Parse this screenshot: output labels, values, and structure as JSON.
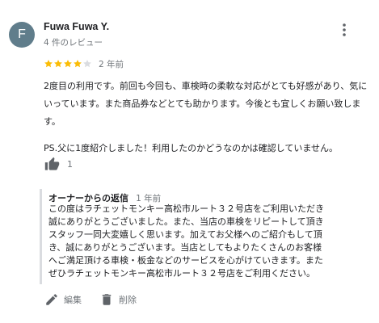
{
  "reviewer": {
    "avatar_letter": "F",
    "avatar_color": "#607d8b",
    "name": "Fuwa Fuwa Y.",
    "review_count": "4 件のレビュー"
  },
  "review": {
    "rating": 4,
    "max_rating": 5,
    "star_color": "#fbbc04",
    "star_empty_color": "#dadce0",
    "date": "2 年前",
    "paragraphs": [
      "2度目の利用です。前回も今回も、車検時の柔軟な対応がとても好感があり、気にいっています。また商品券などとても助かります。今後とも宜しくお願い致します。",
      "PS.父に1度紹介しました！利用したのかどうなのかは確認していません。"
    ],
    "like_count": "1"
  },
  "owner_reply": {
    "label": "オーナーからの返信",
    "date": "1 年前",
    "lines": [
      "この度はラチェットモンキー高松市ルート３２号店をご利用いただき",
      "誠にありがとうございました。また、当店の車検をリピートして頂き",
      "スタッフ一同大変嬉しく思います。加えてお父様へのご紹介もして頂",
      "き、誠にありがとうございます。当店としてもよりたくさんのお客様",
      "へご満足頂ける車検・板金などのサービスを心がけていきます。また",
      "ぜひラチェットモンキー高松市ルート３２号店をご利用ください。"
    ]
  },
  "actions": {
    "edit_label": "編集",
    "delete_label": "削除"
  },
  "icons": {
    "more": "more-vert-icon",
    "like": "thumb-up-icon",
    "edit": "pencil-icon",
    "delete": "trash-icon"
  }
}
